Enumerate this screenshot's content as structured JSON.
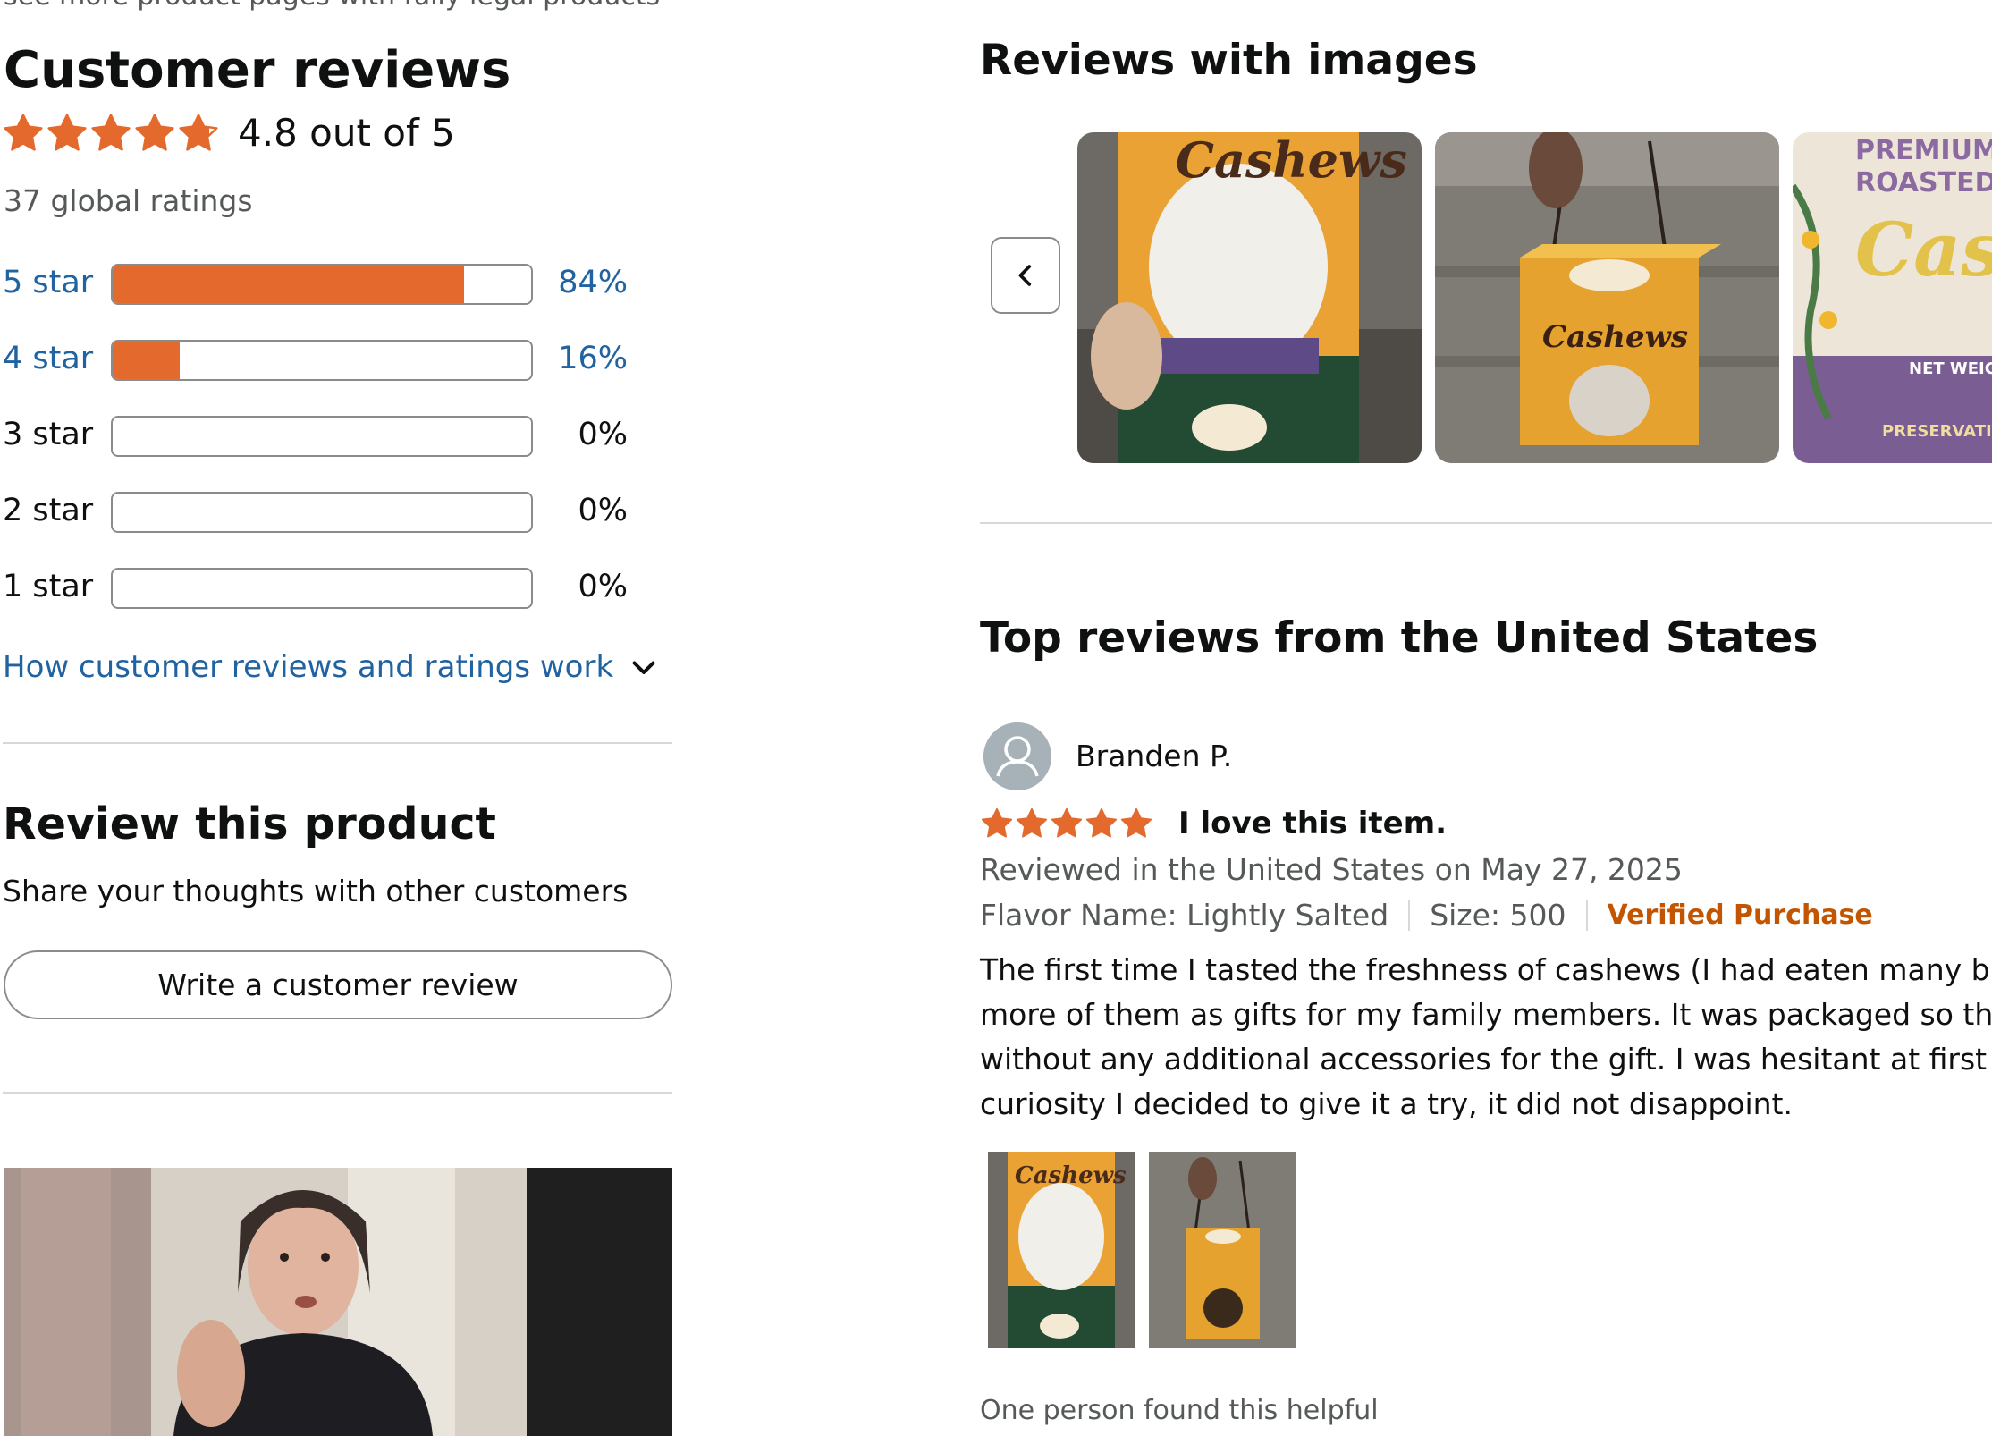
{
  "header_fragment": "see more product pages with fully legal products",
  "summary": {
    "title": "Customer reviews",
    "rating_stars": 4.8,
    "average_text": "4.8 out of 5",
    "global_ratings": "37 global ratings"
  },
  "histogram": [
    {
      "label": "5 star",
      "percent": 84,
      "percent_text": "84%",
      "is_link": true
    },
    {
      "label": "4 star",
      "percent": 16,
      "percent_text": "16%",
      "is_link": true
    },
    {
      "label": "3 star",
      "percent": 0,
      "percent_text": "0%",
      "is_link": false
    },
    {
      "label": "2 star",
      "percent": 0,
      "percent_text": "0%",
      "is_link": false
    },
    {
      "label": "1 star",
      "percent": 0,
      "percent_text": "0%",
      "is_link": false
    }
  ],
  "how_reviews_work": "How customer reviews and ratings work",
  "review_product": {
    "title": "Review this product",
    "subtitle": "Share your thoughts with other customers",
    "button_label": "Write a customer review"
  },
  "reviews_with_images": {
    "title": "Reviews with images"
  },
  "top_reviews": {
    "title": "Top reviews from the United States"
  },
  "review": {
    "author": "Branden P.",
    "stars": 5,
    "title": "I love this item.",
    "date_line": "Reviewed in the United States on May 27, 2025",
    "flavor": "Flavor Name: Lightly Salted",
    "size": "Size: 500",
    "verified": "Verified Purchase",
    "body_lines": [
      "The first time I tasted the freshness of cashews (I had eaten many brand",
      "more of them as gifts for my family members. It was packaged so that I",
      "without any additional accessories for the gift. I was hesitant at first wh",
      "curiosity I decided to give it a try, it did not disappoint."
    ],
    "helpful": "One person found this helpful"
  },
  "colors": {
    "star": "#e3692c",
    "link": "#2162a1",
    "verified": "#c45500",
    "bar_fill": "#e3692c"
  }
}
